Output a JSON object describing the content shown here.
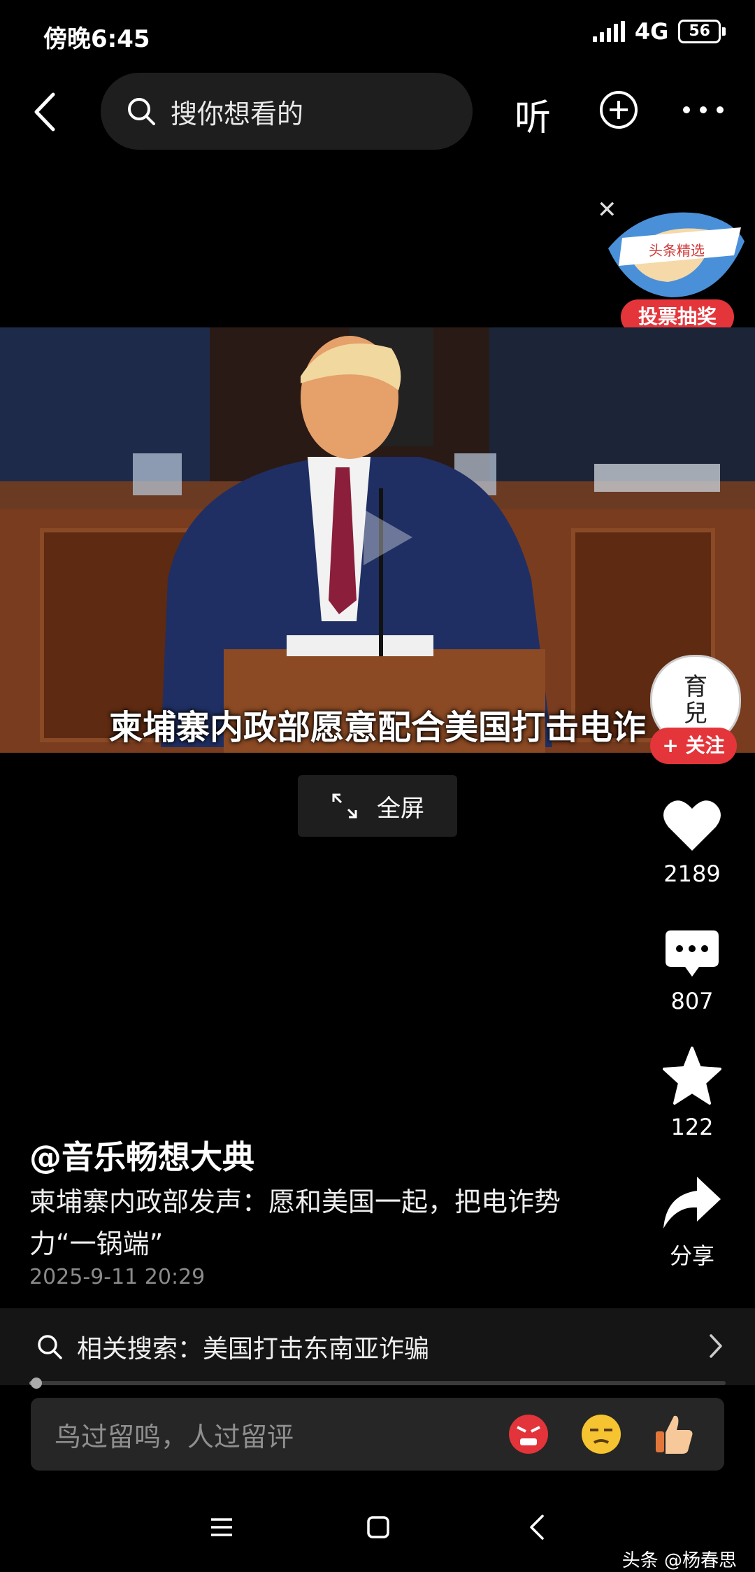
{
  "status_bar": {
    "time": "傍晚6:45",
    "network": "4G",
    "battery": "56"
  },
  "top_nav": {
    "search_placeholder": "搜你想看的",
    "listen_label": "听"
  },
  "promo": {
    "badge_text": "头条精选",
    "label": "投票抽奖"
  },
  "video": {
    "subtitle": "柬埔寨内政部愿意配合美国打击电诈",
    "fullscreen_label": "全屏"
  },
  "follow": {
    "avatar_text": "育兒",
    "button_label": "+ 关注"
  },
  "rail": {
    "likes": "2189",
    "comments": "807",
    "favorites": "122",
    "share_label": "分享"
  },
  "post": {
    "author": "@音乐畅想大典",
    "description": "柬埔寨内政部发声：愿和美国一起，把电诈势力“一锅端”",
    "timestamp": "2025-9-11 20:29"
  },
  "related_search": {
    "text": "相关搜索：美国打击东南亚诈骗"
  },
  "progress": {
    "played_fraction": 0.01
  },
  "comment": {
    "placeholder": "鸟过留鸣，人过留评"
  },
  "watermark": "头条 @杨春思",
  "colors": {
    "accent_red": "#e4353b",
    "background": "#000000"
  }
}
